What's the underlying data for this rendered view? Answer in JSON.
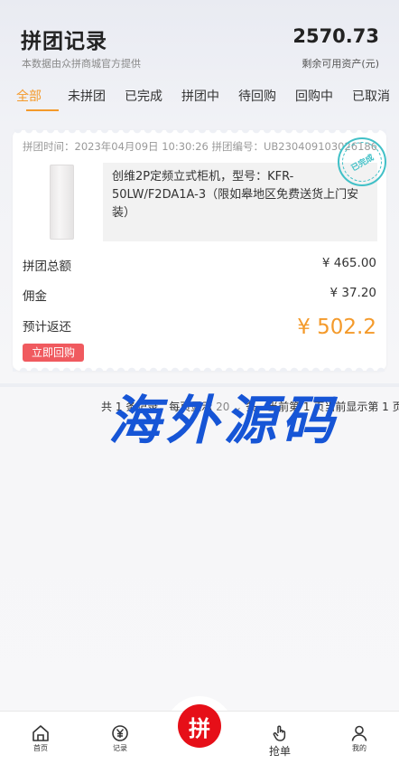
{
  "header": {
    "title": "拼团记录",
    "subtitle": "本数据由众拼商城官方提供",
    "balance": "2570.73",
    "balance_label": "剩余可用资产(元)"
  },
  "tabs": [
    {
      "label": "全部",
      "active": true
    },
    {
      "label": "未拼团",
      "active": false
    },
    {
      "label": "已完成",
      "active": false
    },
    {
      "label": "拼团中",
      "active": false
    },
    {
      "label": "待回购",
      "active": false
    },
    {
      "label": "回购中",
      "active": false
    },
    {
      "label": "已取消",
      "active": false
    }
  ],
  "order": {
    "meta": "拼团时间：2023年04月09日 10:30:26 拼团编号：UB2304091030261862",
    "product_title": "创维2P定频立式柜机，型号：KFR-50LW/F2DA1A-3（限如皋地区免费送货上门安装）",
    "stamp_text": "已完成",
    "total_label": "拼团总额",
    "total_value": "¥ 465.00",
    "commission_label": "佣金",
    "commission_value": "¥ 37.20",
    "refund_label": "预计返还",
    "refund_value": "¥ 502.2",
    "buyback_button": "立即回购"
  },
  "pagination": {
    "prefix": "共 1 条记录，每页显示",
    "page_size": "20",
    "suffix": "条，当前第 1 页当前显示第 1 页。"
  },
  "watermark": "海外源码",
  "bottom_nav": {
    "home": "首页",
    "records": "记录",
    "center_icon": "拼",
    "grab": "抢单",
    "mine": "我的"
  },
  "colors": {
    "accent": "#f49a2b",
    "buyback_red": "#f05a5f",
    "center_red": "#e60f18",
    "stamp_teal": "#41c0c7",
    "watermark_blue": "#1655d6"
  }
}
